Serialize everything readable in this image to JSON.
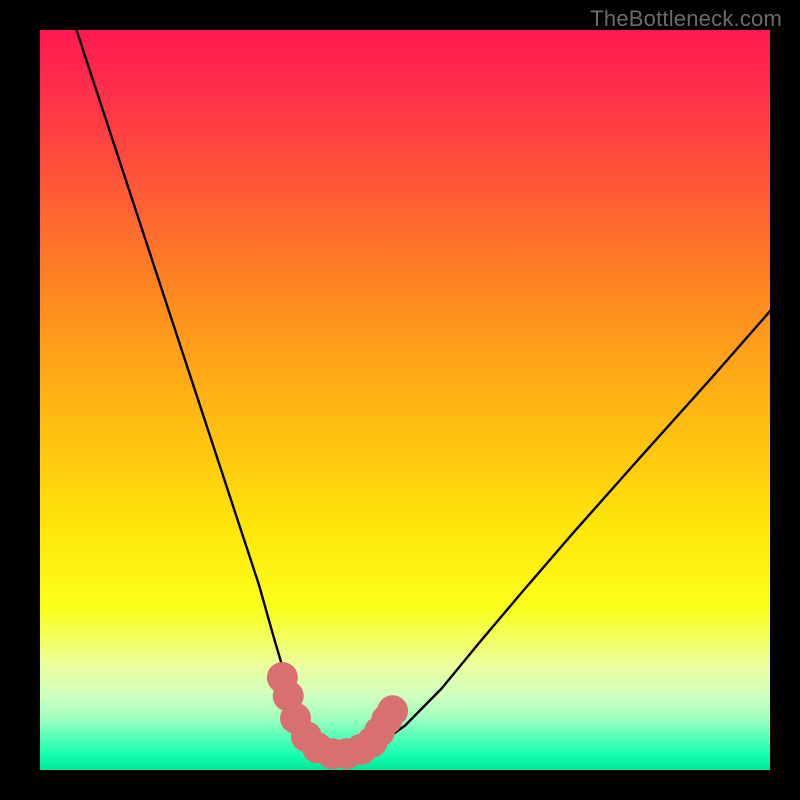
{
  "watermark": "TheBottleneck.com",
  "chart_data": {
    "type": "line",
    "title": "",
    "xlabel": "",
    "ylabel": "",
    "xlim": [
      0,
      100
    ],
    "ylim": [
      0,
      100
    ],
    "grid": false,
    "legend": false,
    "background_gradient": {
      "top": "#ff1a52",
      "mid": "#ffe80a",
      "bottom": "#00e69a"
    },
    "series": [
      {
        "name": "bottleneck-curve",
        "stroke": "#000000",
        "x": [
          5,
          10,
          15,
          20,
          25,
          28,
          30,
          32,
          33.5,
          35,
          37,
          38.5,
          40,
          43,
          46,
          50,
          55,
          60,
          66,
          73,
          82,
          92,
          100
        ],
        "y": [
          100,
          85,
          70,
          55,
          40,
          31,
          25,
          18,
          13,
          9,
          5,
          3,
          2.2,
          2.2,
          3.2,
          6,
          11,
          17,
          24,
          32,
          42,
          53,
          62
        ]
      },
      {
        "name": "marker-band",
        "stroke": "#d86f70",
        "type": "scatter",
        "x": [
          33.2,
          34.0,
          35.0,
          36.5,
          38.0,
          40.0,
          42.0,
          44.0,
          45.5,
          46.5,
          47.5,
          48.3
        ],
        "y": [
          12.5,
          10.0,
          7.0,
          4.5,
          3.0,
          2.2,
          2.2,
          2.8,
          3.8,
          5.2,
          6.8,
          8.0
        ],
        "marker_radius": 2.6
      }
    ]
  }
}
